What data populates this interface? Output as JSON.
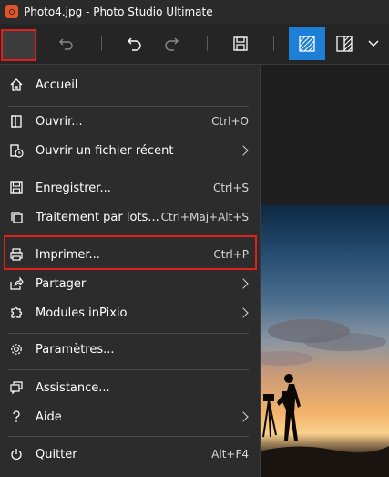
{
  "window": {
    "title": "Photo4.jpg - Photo Studio Ultimate"
  },
  "toolbar": {
    "buttons": [
      {
        "name": "menu",
        "icon": "hamburger-icon"
      },
      {
        "name": "undo-back",
        "icon": "undo-back-icon"
      },
      {
        "name": "undo",
        "icon": "undo-icon"
      },
      {
        "name": "redo",
        "icon": "redo-icon"
      },
      {
        "name": "save",
        "icon": "save-icon"
      },
      {
        "name": "view-single",
        "icon": "view-single-icon"
      },
      {
        "name": "view-compare",
        "icon": "view-compare-icon"
      },
      {
        "name": "more",
        "icon": "chevron-down-icon"
      }
    ],
    "accent": "#1e7fd6"
  },
  "highlight_color": "#e0201c",
  "menu": {
    "items": [
      {
        "id": "home",
        "label": "Accueil",
        "shortcut": "",
        "icon": "home-icon",
        "submenu": false
      },
      {
        "id": "open",
        "label": "Ouvrir...",
        "shortcut": "Ctrl+O",
        "icon": "open-icon",
        "submenu": false
      },
      {
        "id": "recent",
        "label": "Ouvrir un fichier récent",
        "shortcut": "",
        "icon": "recent-icon",
        "submenu": true
      },
      {
        "id": "save",
        "label": "Enregistrer...",
        "shortcut": "Ctrl+S",
        "icon": "save-icon",
        "submenu": false
      },
      {
        "id": "batch",
        "label": "Traitement par lots...",
        "shortcut": "Ctrl+Maj+Alt+S",
        "icon": "batch-icon",
        "submenu": false
      },
      {
        "id": "print",
        "label": "Imprimer...",
        "shortcut": "Ctrl+P",
        "icon": "print-icon",
        "submenu": false
      },
      {
        "id": "share",
        "label": "Partager",
        "shortcut": "",
        "icon": "share-icon",
        "submenu": true
      },
      {
        "id": "modules",
        "label": "Modules inPixio",
        "shortcut": "",
        "icon": "puzzle-icon",
        "submenu": true
      },
      {
        "id": "settings",
        "label": "Paramètres...",
        "shortcut": "",
        "icon": "gear-icon",
        "submenu": false
      },
      {
        "id": "support",
        "label": "Assistance...",
        "shortcut": "",
        "icon": "chat-icon",
        "submenu": false
      },
      {
        "id": "help",
        "label": "Aide",
        "shortcut": "",
        "icon": "help-icon",
        "submenu": true
      },
      {
        "id": "quit",
        "label": "Quitter",
        "shortcut": "Alt+F4",
        "icon": "power-icon",
        "submenu": false
      }
    ]
  }
}
